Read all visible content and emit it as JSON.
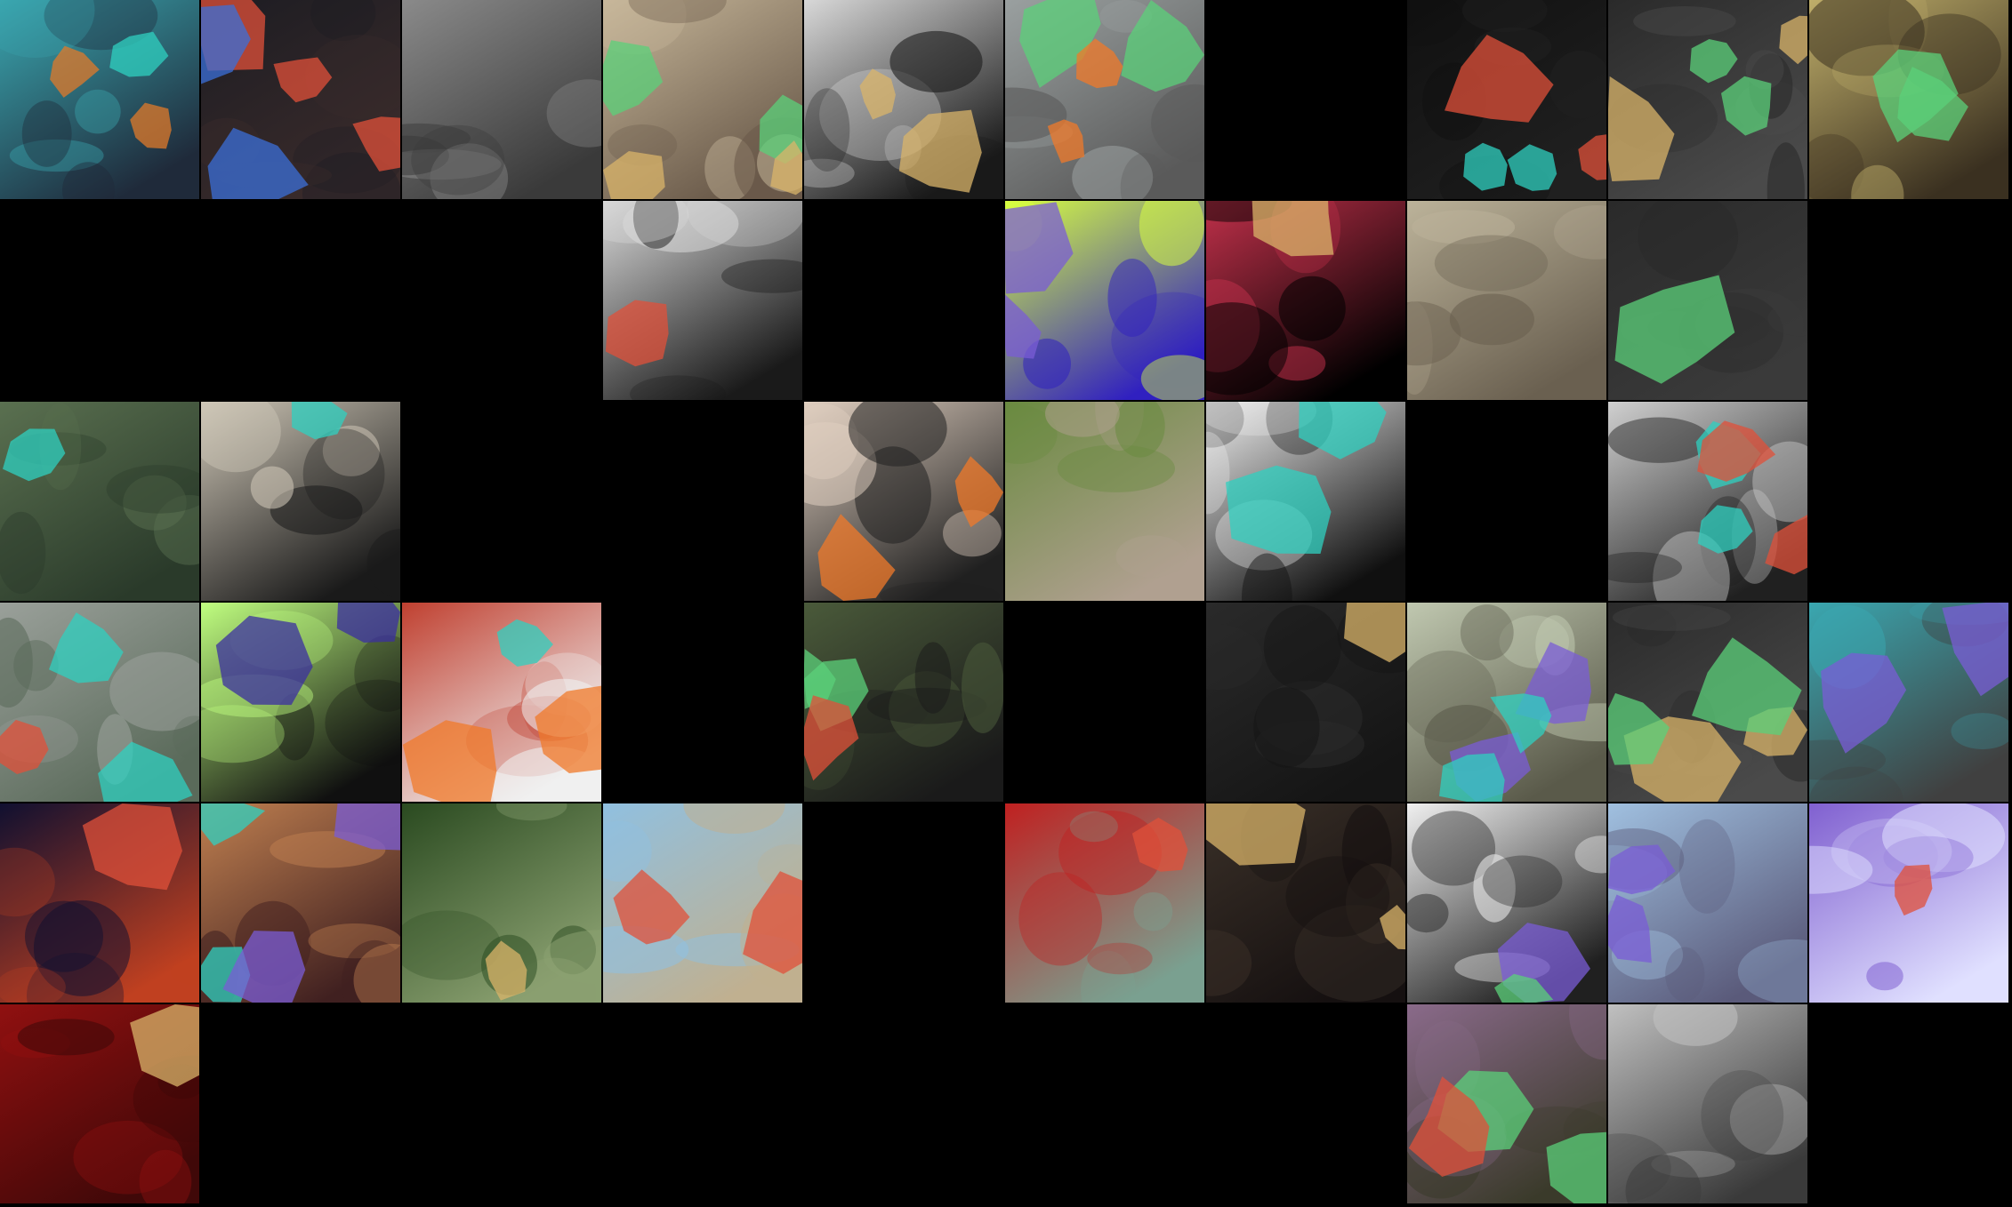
{
  "grid": {
    "rows": 6,
    "cols": 10,
    "background": "#000000"
  },
  "overlay_colors": [
    "#2fd0c0",
    "#e0503a",
    "#7a5cd6",
    "#f07a2a",
    "#d9b46a",
    "#5bd07a",
    "#3b6fd8",
    "#e8e26a"
  ],
  "tiles": [
    {
      "id": "t0-0",
      "scene": "person-dark-hat-teal-overlay",
      "bg": [
        "#3aa7b0",
        "#1f2a3a"
      ],
      "blobs": [
        [
          "#2fd0c0",
          0.2
        ],
        [
          "#e07a2a",
          0.5
        ]
      ]
    },
    {
      "id": "t0-1",
      "scene": "car-dashboard-red-overlay",
      "bg": [
        "#1c1c22",
        "#3a2b2b"
      ],
      "blobs": [
        [
          "#e0503a",
          0.7
        ],
        [
          "#3b6fd8",
          0.4
        ]
      ]
    },
    {
      "id": "t0-2",
      "scene": "horse-in-parking-lot",
      "bg": [
        "#8a8a8a",
        "#3a3a3a"
      ],
      "blobs": []
    },
    {
      "id": "t0-3",
      "scene": "wedding-photo-frame-overlay",
      "bg": [
        "#c7b79a",
        "#6a5a4a"
      ],
      "blobs": [
        [
          "#5bd07a",
          0.5
        ],
        [
          "#d9b46a",
          0.5
        ]
      ]
    },
    {
      "id": "t0-4",
      "scene": "house-black-white-picnic",
      "bg": [
        "#d8d8d8",
        "#1a1a1a"
      ],
      "blobs": [
        [
          "#d9b46a",
          0.4
        ]
      ]
    },
    {
      "id": "t0-5",
      "scene": "living-room-tv-overlay",
      "bg": [
        "#9aa0a0",
        "#5a5a5a"
      ],
      "blobs": [
        [
          "#5bd07a",
          0.6
        ],
        [
          "#f07a2a",
          0.4
        ]
      ]
    },
    {
      "id": "t0-6",
      "scene": "empty",
      "bg": [
        "#000000",
        "#000000"
      ],
      "blobs": []
    },
    {
      "id": "t0-7",
      "scene": "dark-scene-teal-red-overlay",
      "bg": [
        "#101010",
        "#202020"
      ],
      "blobs": [
        [
          "#2fd0c0",
          0.6
        ],
        [
          "#e0503a",
          0.6
        ]
      ]
    },
    {
      "id": "t0-8",
      "scene": "camera-gear-multi-overlay",
      "bg": [
        "#2a2a2a",
        "#4a4a4a"
      ],
      "blobs": [
        [
          "#d9b46a",
          0.6
        ],
        [
          "#5bd07a",
          0.5
        ]
      ]
    },
    {
      "id": "t0-9",
      "scene": "tabby-cat-sleeping",
      "bg": [
        "#bfae6a",
        "#3a3020"
      ],
      "blobs": [
        [
          "#5bd07a",
          0.5
        ]
      ]
    },
    {
      "id": "t1-0",
      "scene": "empty",
      "bg": [
        "#000000",
        "#000000"
      ],
      "blobs": []
    },
    {
      "id": "t1-1",
      "scene": "empty",
      "bg": [
        "#000000",
        "#000000"
      ],
      "blobs": []
    },
    {
      "id": "t1-2",
      "scene": "empty",
      "bg": [
        "#000000",
        "#000000"
      ],
      "blobs": []
    },
    {
      "id": "t1-3",
      "scene": "house-black-white-picnic",
      "bg": [
        "#d8d8d8",
        "#1a1a1a"
      ],
      "blobs": [
        [
          "#e0503a",
          0.3
        ]
      ]
    },
    {
      "id": "t1-4",
      "scene": "empty",
      "bg": [
        "#000000",
        "#000000"
      ],
      "blobs": []
    },
    {
      "id": "t1-5",
      "scene": "motorcycle-vivid",
      "bg": [
        "#d8ff40",
        "#3020c0"
      ],
      "blobs": [
        [
          "#7a5cd6",
          0.6
        ]
      ]
    },
    {
      "id": "t1-6",
      "scene": "red-fluffy-dog",
      "bg": [
        "#c0304a",
        "#000000"
      ],
      "blobs": [
        [
          "#d9b46a",
          0.3
        ]
      ]
    },
    {
      "id": "t1-7",
      "scene": "wedding-photo-frame",
      "bg": [
        "#bcb39a",
        "#6a6050"
      ],
      "blobs": []
    },
    {
      "id": "t1-8",
      "scene": "dark-bus-green-overlay",
      "bg": [
        "#2a2a2a",
        "#3a3a3a"
      ],
      "blobs": [
        [
          "#5bd07a",
          0.3
        ]
      ]
    },
    {
      "id": "t1-9",
      "scene": "empty",
      "bg": [
        "#000000",
        "#000000"
      ],
      "blobs": []
    },
    {
      "id": "t2-0",
      "scene": "man-glasses-green-hoodie",
      "bg": [
        "#5a7050",
        "#2a3a2a"
      ],
      "blobs": [
        [
          "#2fd0c0",
          0.2
        ]
      ]
    },
    {
      "id": "t2-1",
      "scene": "chefs-in-kitchen",
      "bg": [
        "#cfc7b7",
        "#1a1a1a"
      ],
      "blobs": [
        [
          "#2fd0c0",
          0.2
        ]
      ]
    },
    {
      "id": "t2-2",
      "scene": "empty",
      "bg": [
        "#000000",
        "#000000"
      ],
      "blobs": []
    },
    {
      "id": "t2-3",
      "scene": "empty",
      "bg": [
        "#000000",
        "#000000"
      ],
      "blobs": []
    },
    {
      "id": "t2-4",
      "scene": "two-women-on-bench",
      "bg": [
        "#e0cfc0",
        "#202020"
      ],
      "blobs": [
        [
          "#f07a2a",
          0.6
        ]
      ]
    },
    {
      "id": "t2-5",
      "scene": "colorful-blankets",
      "bg": [
        "#6a8a40",
        "#b0a090"
      ],
      "blobs": []
    },
    {
      "id": "t2-6",
      "scene": "person-motorbike-bw-teal",
      "bg": [
        "#f0f0f0",
        "#101010"
      ],
      "blobs": [
        [
          "#2fd0c0",
          0.6
        ]
      ]
    },
    {
      "id": "t2-7",
      "scene": "empty",
      "bg": [
        "#000000",
        "#000000"
      ],
      "blobs": []
    },
    {
      "id": "t2-8",
      "scene": "house-picnic-overlay",
      "bg": [
        "#d0d0d0",
        "#202020"
      ],
      "blobs": [
        [
          "#2fd0c0",
          0.6
        ],
        [
          "#e0503a",
          0.4
        ]
      ]
    },
    {
      "id": "t2-9",
      "scene": "empty",
      "bg": [
        "#000000",
        "#000000"
      ],
      "blobs": []
    },
    {
      "id": "t3-0",
      "scene": "child-umbrella-rain",
      "bg": [
        "#9aa09a",
        "#5a6a5a"
      ],
      "blobs": [
        [
          "#2fd0c0",
          0.4
        ],
        [
          "#e0503a",
          0.3
        ]
      ]
    },
    {
      "id": "t3-1",
      "scene": "green-purple-abstract",
      "bg": [
        "#c0ff80",
        "#101010"
      ],
      "blobs": [
        [
          "#3b2fa0",
          0.6
        ]
      ]
    },
    {
      "id": "t3-2",
      "scene": "shop-sign-banh-bao",
      "bg": [
        "#c04030",
        "#f0f0f0"
      ],
      "blobs": [
        [
          "#f07a2a",
          0.4
        ],
        [
          "#2fd0c0",
          0.3
        ]
      ]
    },
    {
      "id": "t3-3",
      "scene": "empty",
      "bg": [
        "#000000",
        "#000000"
      ],
      "blobs": []
    },
    {
      "id": "t3-4",
      "scene": "three-friends-selfie",
      "bg": [
        "#4a5a3a",
        "#1a1a1a"
      ],
      "blobs": [
        [
          "#5bd07a",
          0.4
        ],
        [
          "#e0503a",
          0.2
        ]
      ]
    },
    {
      "id": "t3-5",
      "scene": "empty",
      "bg": [
        "#000000",
        "#000000"
      ],
      "blobs": []
    },
    {
      "id": "t3-6",
      "scene": "dark-luggage",
      "bg": [
        "#2a2a2a",
        "#151515"
      ],
      "blobs": [
        [
          "#d9b46a",
          0.2
        ]
      ]
    },
    {
      "id": "t3-7",
      "scene": "person-blue-glasses",
      "bg": [
        "#c0c8b0",
        "#5a5a4a"
      ],
      "blobs": [
        [
          "#7a5cd6",
          0.5
        ],
        [
          "#2fd0c0",
          0.4
        ]
      ]
    },
    {
      "id": "t3-8",
      "scene": "camera-gear-multi-overlay",
      "bg": [
        "#2a2a2a",
        "#4a4a4a"
      ],
      "blobs": [
        [
          "#d9b46a",
          0.6
        ],
        [
          "#5bd07a",
          0.5
        ]
      ]
    },
    {
      "id": "t3-9",
      "scene": "teal-purple-abstract",
      "bg": [
        "#3aa7b0",
        "#404040"
      ],
      "blobs": [
        [
          "#7a5cd6",
          0.5
        ]
      ]
    },
    {
      "id": "t4-0",
      "scene": "tv-man-face",
      "bg": [
        "#101030",
        "#c04020"
      ],
      "blobs": [
        [
          "#e0503a",
          0.3
        ]
      ]
    },
    {
      "id": "t4-1",
      "scene": "ten-speed-bicycle-poster",
      "bg": [
        "#c08050",
        "#402020"
      ],
      "blobs": [
        [
          "#2fd0c0",
          0.5
        ],
        [
          "#7a5cd6",
          0.4
        ]
      ]
    },
    {
      "id": "t4-2",
      "scene": "traffic-light-trees",
      "bg": [
        "#2a4a20",
        "#8aa070"
      ],
      "blobs": [
        [
          "#d9b46a",
          0.3
        ]
      ]
    },
    {
      "id": "t4-3",
      "scene": "horse-race-beach",
      "bg": [
        "#90c0e0",
        "#c0b090"
      ],
      "blobs": [
        [
          "#e0503a",
          0.4
        ]
      ]
    },
    {
      "id": "t4-4",
      "scene": "empty",
      "bg": [
        "#000000",
        "#000000"
      ],
      "blobs": []
    },
    {
      "id": "t4-5",
      "scene": "red-lips-closeup",
      "bg": [
        "#c02020",
        "#7aa090"
      ],
      "blobs": [
        [
          "#e0503a",
          0.3
        ]
      ]
    },
    {
      "id": "t4-6",
      "scene": "dark-shoe-wood",
      "bg": [
        "#3a3028",
        "#151010"
      ],
      "blobs": [
        [
          "#d9b46a",
          0.4
        ]
      ]
    },
    {
      "id": "t4-7",
      "scene": "cyclist-shadow-bw",
      "bg": [
        "#f0f0f0",
        "#202020"
      ],
      "blobs": [
        [
          "#7a5cd6",
          0.3
        ],
        [
          "#5bd07a",
          0.3
        ]
      ]
    },
    {
      "id": "t4-8",
      "scene": "train-station-sky",
      "bg": [
        "#a0c0e0",
        "#5a5a7a"
      ],
      "blobs": [
        [
          "#7a5cd6",
          0.5
        ]
      ]
    },
    {
      "id": "t4-9",
      "scene": "snowboarder-purple",
      "bg": [
        "#8060d0",
        "#e0e0ff"
      ],
      "blobs": [
        [
          "#e0503a",
          0.3
        ]
      ]
    },
    {
      "id": "t5-0",
      "scene": "red-room-wooden-floor",
      "bg": [
        "#901010",
        "#400808"
      ],
      "blobs": [
        [
          "#d9b46a",
          0.2
        ]
      ]
    },
    {
      "id": "t5-1",
      "scene": "empty",
      "bg": [
        "#000000",
        "#000000"
      ],
      "blobs": []
    },
    {
      "id": "t5-2",
      "scene": "empty",
      "bg": [
        "#000000",
        "#000000"
      ],
      "blobs": []
    },
    {
      "id": "t5-3",
      "scene": "empty",
      "bg": [
        "#000000",
        "#000000"
      ],
      "blobs": []
    },
    {
      "id": "t5-4",
      "scene": "empty",
      "bg": [
        "#000000",
        "#000000"
      ],
      "blobs": []
    },
    {
      "id": "t5-5",
      "scene": "empty",
      "bg": [
        "#000000",
        "#000000"
      ],
      "blobs": []
    },
    {
      "id": "t5-6",
      "scene": "empty",
      "bg": [
        "#000000",
        "#000000"
      ],
      "blobs": []
    },
    {
      "id": "t5-7",
      "scene": "woman-market-hat",
      "bg": [
        "#8a6a8a",
        "#3a3a2a"
      ],
      "blobs": [
        [
          "#5bd07a",
          0.4
        ],
        [
          "#e0503a",
          0.3
        ]
      ]
    },
    {
      "id": "t5-8",
      "scene": "child-people-street",
      "bg": [
        "#c0c0c0",
        "#3a3a3a"
      ],
      "blobs": []
    },
    {
      "id": "t5-9",
      "scene": "empty",
      "bg": [
        "#000000",
        "#000000"
      ],
      "blobs": []
    }
  ]
}
